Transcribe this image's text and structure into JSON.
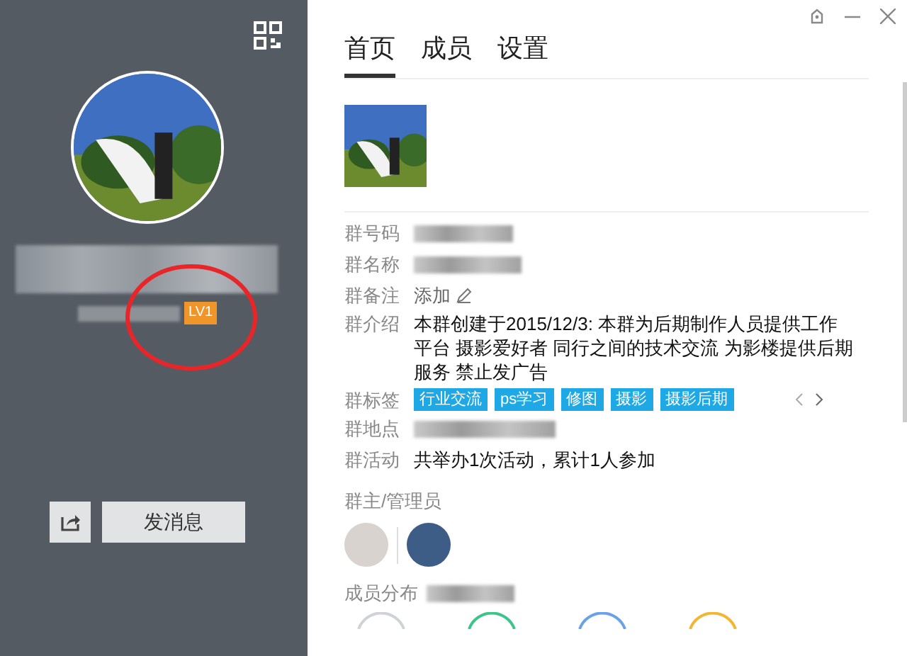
{
  "sidebar": {
    "level_badge": "LV1",
    "send_button": "发消息"
  },
  "tabs": [
    {
      "label": "首页",
      "selected": true
    },
    {
      "label": "成员",
      "selected": false
    },
    {
      "label": "设置",
      "selected": false
    }
  ],
  "info_rows": [
    {
      "label": "群号码",
      "kind": "blurred"
    },
    {
      "label": "群名称",
      "kind": "blurred"
    },
    {
      "label": "群备注",
      "kind": "link",
      "value": "添加"
    },
    {
      "label": "群介绍",
      "kind": "text",
      "value": "本群创建于2015/12/3:  本群为后期制作人员提供工作平台 摄影爱好者  同行之间的技术交流  为影楼提供后期服务  禁止发广告"
    },
    {
      "label": "群标签",
      "kind": "tags",
      "tags": [
        "行业交流",
        "ps学习",
        "修图",
        "摄影",
        "摄影后期"
      ]
    },
    {
      "label": "群地点",
      "kind": "blurred"
    },
    {
      "label": "群活动",
      "kind": "text",
      "value": "共举办1次活动，累计1人参加"
    }
  ],
  "admins": {
    "title": "群主/管理员"
  },
  "members": {
    "title": "成员分布",
    "rings": [
      {
        "color": "#cfd3d8"
      },
      {
        "color": "#3cc48a"
      },
      {
        "color": "#6aa2e8"
      },
      {
        "color": "#f2b632"
      }
    ]
  }
}
